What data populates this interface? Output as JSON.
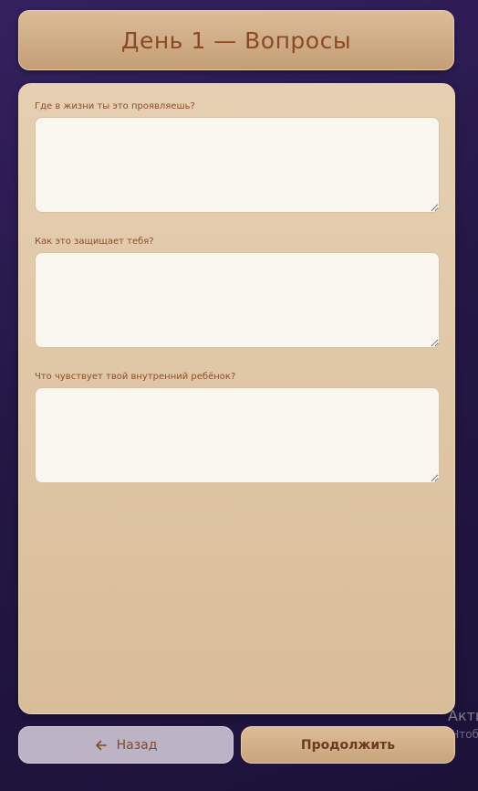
{
  "header": {
    "title": "День 1 — Вопросы"
  },
  "form": {
    "fields": [
      {
        "label": "Где в жизни ты это проявляешь?",
        "value": "",
        "placeholder": ""
      },
      {
        "label": "Как это защищает тебя?",
        "value": "",
        "placeholder": ""
      },
      {
        "label": "Что чувствует твой внутренний ребёнок?",
        "value": "",
        "placeholder": ""
      }
    ]
  },
  "footer": {
    "back_label": "Назад",
    "back_icon": "arrow-left-icon",
    "continue_label": "Продолжить"
  },
  "watermark": {
    "line1": "Акти",
    "line2": "Чтоб"
  },
  "colors": {
    "accent_text": "#8a4a24",
    "background": "#241745",
    "card": "#e0c6a4"
  }
}
